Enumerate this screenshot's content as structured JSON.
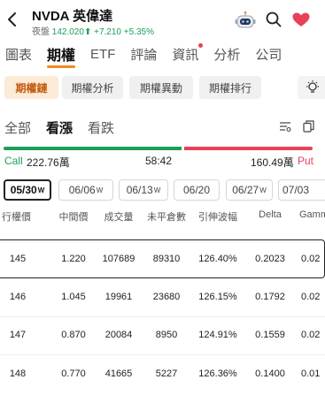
{
  "header": {
    "symbol": "NVDA",
    "name": "英偉達",
    "session": "夜盤",
    "price": "142.020",
    "arrow": "⬆",
    "change": "+7.210",
    "change_pct": "+5.35%",
    "up_color": "#1a9e5a"
  },
  "tabs": [
    "圖表",
    "期權",
    "ETF",
    "評論",
    "資訊",
    "分析",
    "公司"
  ],
  "chips": [
    "期權鏈",
    "期權分析",
    "期權異動",
    "期權排行"
  ],
  "sub_tabs": [
    "全部",
    "看漲",
    "看跌"
  ],
  "ratio": {
    "call_label": "Call",
    "call_value": "222.76萬",
    "ratio": "58:42",
    "put_value": "160.49萬",
    "put_label": "Put",
    "call_share": 0.58,
    "call_color": "#1a9e5a",
    "put_color": "#e8415a"
  },
  "dates": [
    {
      "label": "05/30",
      "sup": "W"
    },
    {
      "label": "06/06",
      "sup": "W"
    },
    {
      "label": "06/13",
      "sup": "W"
    },
    {
      "label": "06/20",
      "sup": ""
    },
    {
      "label": "06/27",
      "sup": "W"
    },
    {
      "label": "07/03",
      "sup": ""
    }
  ],
  "table": {
    "headers": [
      "行權價",
      "中間價",
      "成交量",
      "未平倉數",
      "引伸波幅",
      "Delta",
      "Gamma"
    ],
    "rows": [
      [
        "145",
        "1.220",
        "107689",
        "89310",
        "126.40%",
        "0.2023",
        "0.02"
      ],
      [
        "146",
        "1.045",
        "19961",
        "23680",
        "126.15%",
        "0.1792",
        "0.02"
      ],
      [
        "147",
        "0.870",
        "20084",
        "8950",
        "124.91%",
        "0.1559",
        "0.02"
      ],
      [
        "148",
        "0.770",
        "41665",
        "5227",
        "126.36%",
        "0.1400",
        "0.01"
      ]
    ]
  },
  "icons": {
    "back": "chevron-left-icon",
    "robot": "robot-icon",
    "search": "search-icon",
    "favorite": "heart-icon",
    "bulb": "lightbulb-icon",
    "filter": "filter-icon",
    "copy": "copy-icon"
  }
}
